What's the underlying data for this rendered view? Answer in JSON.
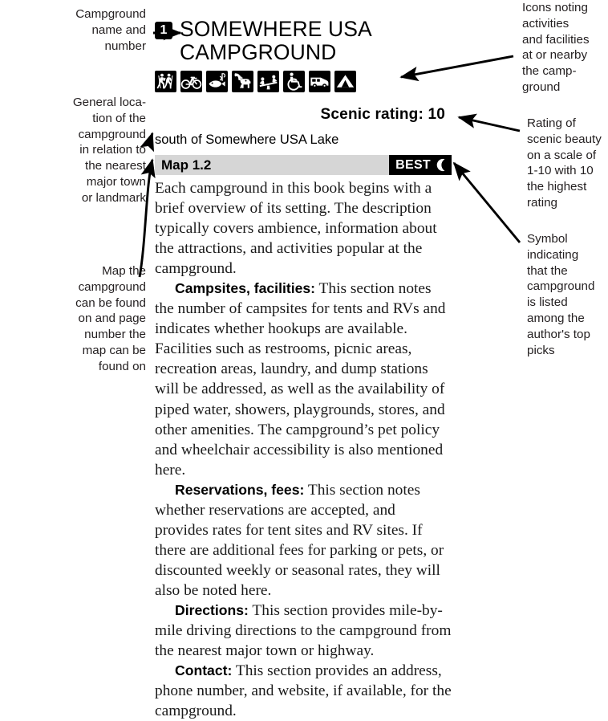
{
  "annotations": {
    "name_and_number": "Campground\nname and\nnumber",
    "general_location": "General loca-\ntion of the\ncampground\nin relation to\nthe nearest\nmajor town\nor landmark",
    "map_reference": "Map the\ncampground\ncan be found\non and page\nnumber the\nmap can be\nfound on",
    "icons_note": "Icons noting\nactivities\nand facilities\nat or nearby\nthe camp-\nground",
    "rating_note": "Rating of\nscenic beauty\non a scale of\n1-10 with 10\nthe highest\nrating",
    "best_note": "Symbol\nindicating\nthat the\ncampground\nis listed\namong the\nauthor's top\npicks"
  },
  "entry": {
    "number": "1",
    "title": "SOMEWHERE USA CAMPGROUND",
    "scenic_rating_label": "Scenic rating: 10",
    "location": "south of Somewhere USA Lake",
    "map_label": "Map 1.2",
    "best_badge_text": "BEST",
    "best_badge_symbol": "crescent-moon"
  },
  "icons": [
    {
      "name": "hiking-icon",
      "label": "Hiking"
    },
    {
      "name": "biking-icon",
      "label": "Biking"
    },
    {
      "name": "fishing-icon",
      "label": "Fishing"
    },
    {
      "name": "pets-icon",
      "label": "Pets permitted"
    },
    {
      "name": "playground-icon",
      "label": "Playground"
    },
    {
      "name": "wheelchair-accessible-icon",
      "label": "Wheelchair accessible"
    },
    {
      "name": "rv-sites-icon",
      "label": "RV sites"
    },
    {
      "name": "tent-sites-icon",
      "label": "Tent sites"
    }
  ],
  "body": {
    "intro": "Each campground in this book begins with a brief overview of its setting. The description typically covers ambience, information about the attractions, and activities popular at the campground.",
    "sections": [
      {
        "heading": "Campsites, facilities:",
        "text": " This section notes the number of campsites for tents and RVs and indicates whether hookups are available. Facilities such as restrooms, picnic areas, recreation areas, laundry, and dump stations will be addressed, as well as the availability of piped water, showers, playgrounds, stores, and other amenities. The campground’s pet policy and wheelchair accessibility is also mentioned here."
      },
      {
        "heading": "Reservations, fees:",
        "text": " This section notes whether reservations are accepted, and provides rates for tent sites and RV sites. If there are additional fees for parking or pets, or discounted weekly or seasonal rates, they will also be noted here."
      },
      {
        "heading": "Directions:",
        "text": " This section provides mile-by-mile driving directions to the campground from the nearest major town or highway."
      },
      {
        "heading": "Contact:",
        "text": " This section provides an address, phone number, and website, if available, for the campground."
      }
    ]
  },
  "colors": {
    "ink": "#000000",
    "map_bar_bg": "#d6d6d6",
    "badge_bg": "#000000",
    "badge_fg": "#ffffff"
  }
}
